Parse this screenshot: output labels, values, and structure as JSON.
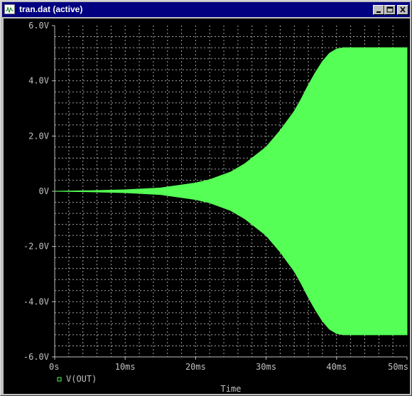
{
  "window": {
    "title": "tran.dat (active)",
    "icon": "probe-window-icon",
    "controls": [
      {
        "name": "minimize-button",
        "icon": "minimize-icon"
      },
      {
        "name": "maximize-button",
        "icon": "maximize-icon"
      },
      {
        "name": "close-button",
        "icon": "close-icon"
      }
    ]
  },
  "colors": {
    "background": "#000000",
    "trace": "#55ff55",
    "axis_text": "#c0c0c0",
    "grid": "#c0c0c0",
    "titlebar": "#000080"
  },
  "chart_data": {
    "type": "area",
    "xlabel": "Time",
    "ylabel": "",
    "xlim": [
      0,
      50
    ],
    "ylim": [
      -6,
      6
    ],
    "x_unit": "ms",
    "grid": true,
    "x_ticks": [
      "0s",
      "10ms",
      "20ms",
      "30ms",
      "40ms",
      "50ms"
    ],
    "y_ticks": [
      "6.0V",
      "4.0V",
      "2.0V",
      "0V",
      "-2.0V",
      "-4.0V",
      "-6.0V"
    ],
    "series": [
      {
        "name": "V(OUT)",
        "kind": "envelope",
        "x": [
          0,
          5,
          10,
          15,
          20,
          22,
          25,
          27,
          30,
          32,
          34,
          35,
          36,
          37,
          38,
          39,
          40,
          41,
          50
        ],
        "upper": [
          0.0,
          0.02,
          0.05,
          0.12,
          0.3,
          0.42,
          0.7,
          1.0,
          1.6,
          2.2,
          2.9,
          3.35,
          3.85,
          4.3,
          4.7,
          5.0,
          5.15,
          5.2,
          5.2
        ],
        "lower": [
          0.0,
          -0.02,
          -0.05,
          -0.12,
          -0.3,
          -0.42,
          -0.7,
          -1.0,
          -1.6,
          -2.2,
          -2.9,
          -3.35,
          -3.85,
          -4.3,
          -4.7,
          -5.0,
          -5.15,
          -5.2,
          -5.2
        ]
      }
    ]
  }
}
